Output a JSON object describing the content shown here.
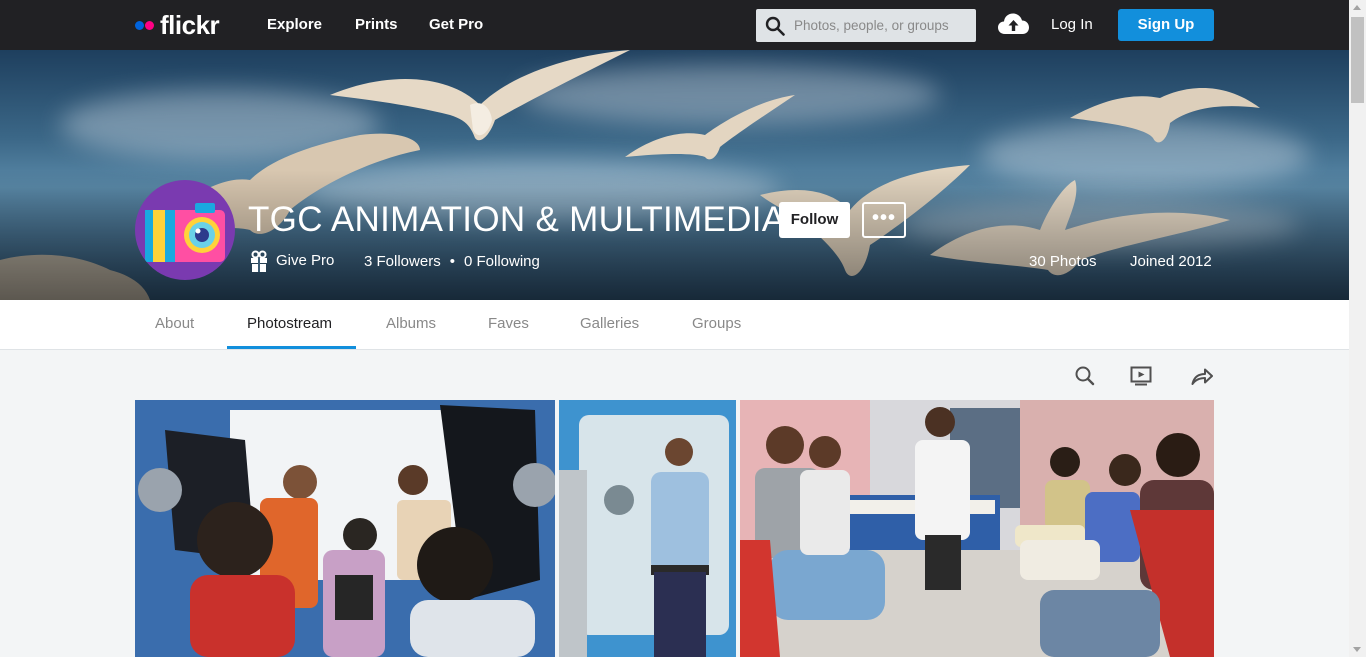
{
  "nav": {
    "logo_text": "flickr",
    "links": [
      "Explore",
      "Prints",
      "Get Pro"
    ],
    "search_placeholder": "Photos, people, or groups",
    "login": "Log In",
    "signup": "Sign Up"
  },
  "profile": {
    "name": "TGC ANIMATION & MULTIMEDIA",
    "follow": "Follow",
    "more": "•••",
    "give_pro": "Give Pro",
    "followers": "3 Followers",
    "separator": "•",
    "following": "0 Following",
    "photos": "30 Photos",
    "joined": "Joined 2012"
  },
  "tabs": [
    {
      "label": "About",
      "active": false
    },
    {
      "label": "Photostream",
      "active": true
    },
    {
      "label": "Albums",
      "active": false
    },
    {
      "label": "Faves",
      "active": false
    },
    {
      "label": "Galleries",
      "active": false
    },
    {
      "label": "Groups",
      "active": false
    }
  ],
  "toolbar": {
    "icons": [
      "search-icon",
      "slideshow-icon",
      "share-icon"
    ]
  },
  "colors": {
    "nav_bg": "#212124",
    "signup_blue": "#128fdc",
    "tab_active_underline": "#128fdc",
    "flickr_blue": "#0063dc",
    "flickr_pink": "#ff0084"
  }
}
